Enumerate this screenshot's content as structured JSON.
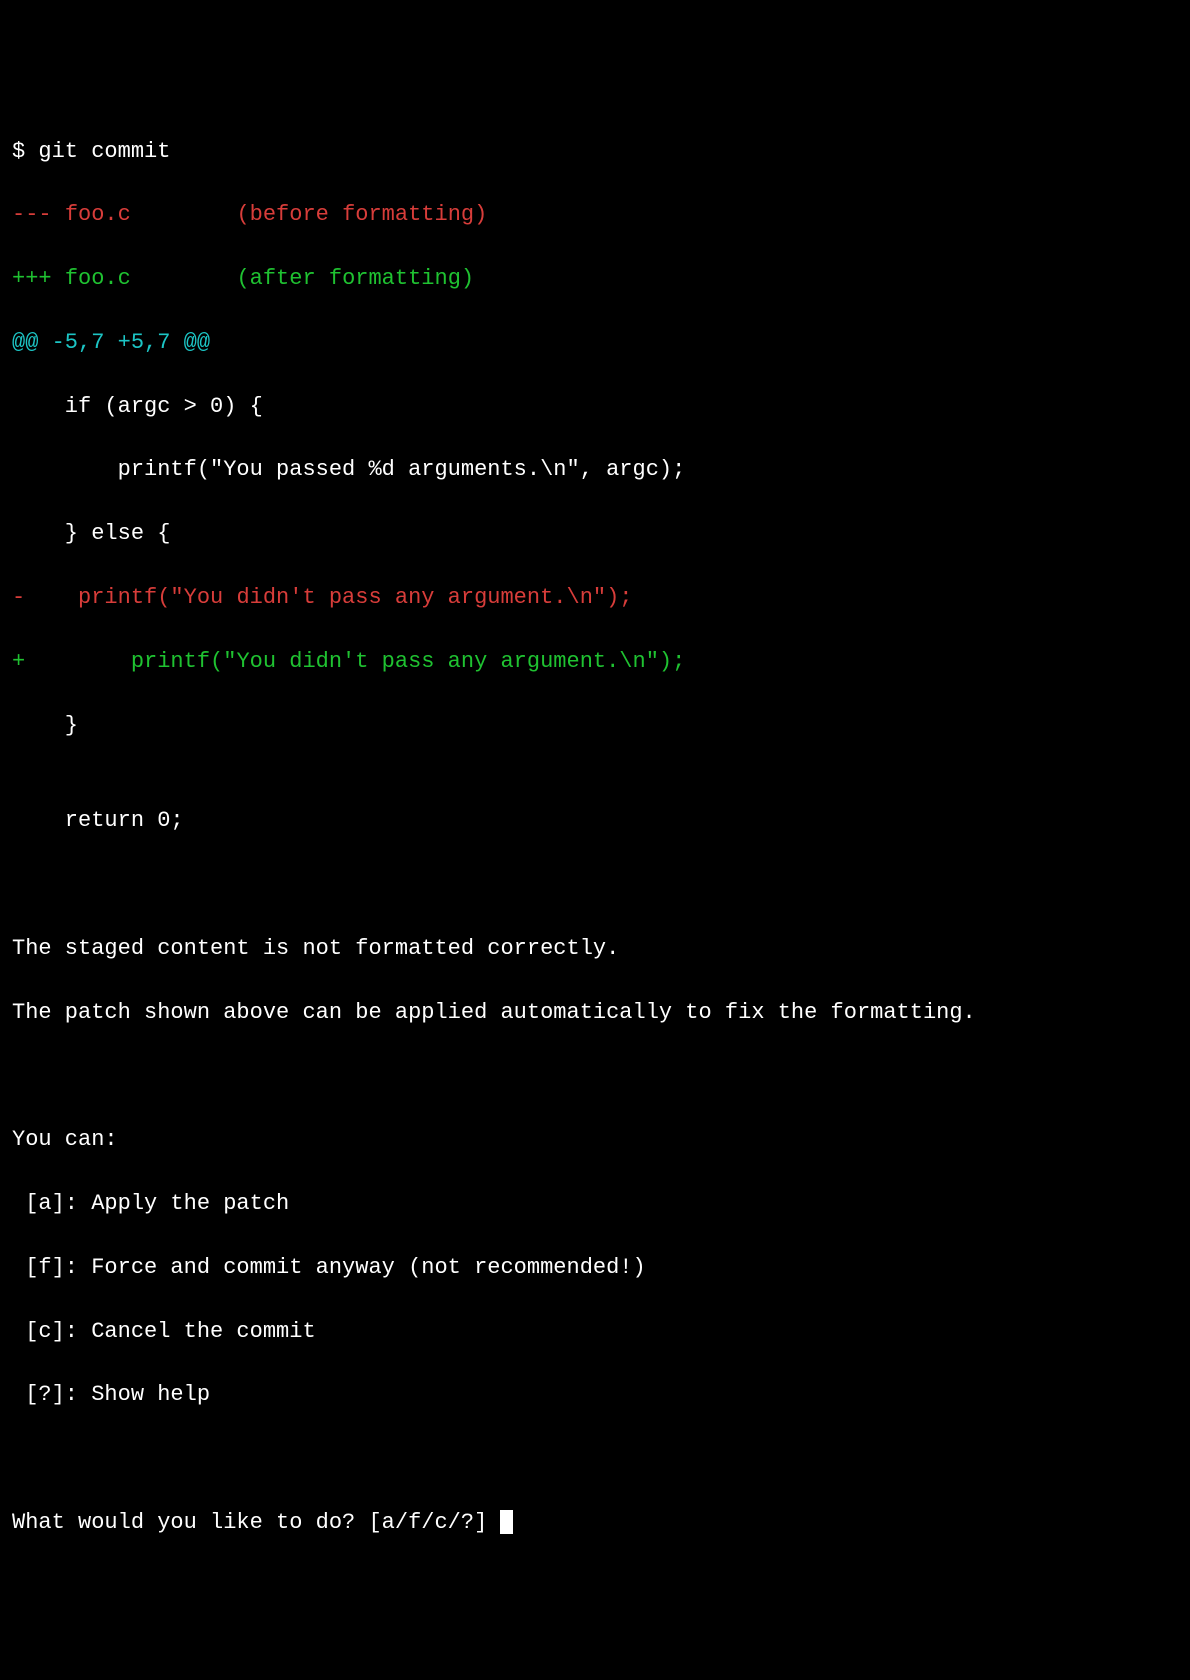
{
  "prompt_symbol": "$",
  "command": "git commit",
  "diff": {
    "header_minus_prefix": "---",
    "header_minus_file": "foo.c",
    "header_minus_note": "(before formatting)",
    "header_plus_prefix": "+++",
    "header_plus_file": "foo.c",
    "header_plus_note": "(after formatting)",
    "hunk": "@@ -5,7 +5,7 @@",
    "context1": "    if (argc > 0) {",
    "context2": "        printf(\"You passed %d arguments.\\n\", argc);",
    "context3": "    } else {",
    "removed_prefix": "-",
    "removed_line": "    printf(\"You didn't pass any argument.\\n\");",
    "added_prefix": "+",
    "added_line": "        printf(\"You didn't pass any argument.\\n\");",
    "context4": "    }",
    "context5": "",
    "context6": "    return 0;"
  },
  "message": {
    "line1": "The staged content is not formatted correctly.",
    "line2": "The patch shown above can be applied automatically to fix the formatting."
  },
  "options": {
    "header": "You can:",
    "a": " [a]: Apply the patch",
    "f": " [f]: Force and commit anyway (not recommended!)",
    "c": " [c]: Cancel the commit",
    "help": " [?]: Show help"
  },
  "question": "What would you like to do? [a/f/c/?] "
}
